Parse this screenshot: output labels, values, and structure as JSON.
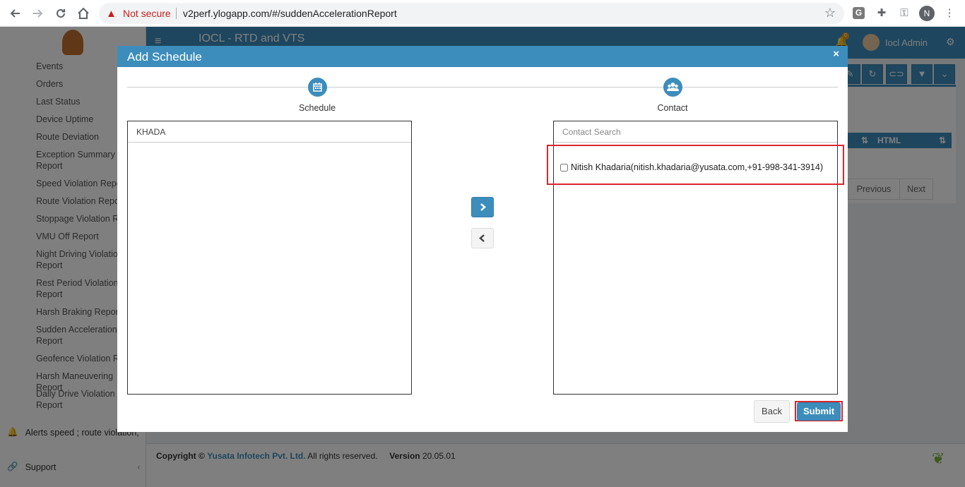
{
  "browser": {
    "security_label": "Not secure",
    "url": "v2perf.ylogapp.com/#/suddenAccelerationReport",
    "profile_initial": "N",
    "ext_g_label": "G"
  },
  "app": {
    "title": "IOCL - RTD and VTS",
    "notification_count": "0",
    "user_name": "Iocl Admin",
    "sidebar_items": [
      "Events",
      "Orders",
      "Last Status",
      "Device Uptime",
      "Route Deviation",
      "Exception Summary Report",
      "Speed Violation Report",
      "Route Violation Report",
      "Stoppage Violation Report",
      "VMU Off Report",
      "Night Driving Violation Report",
      "Rest Period Violation Report",
      "Harsh Braking Report",
      "Sudden Acceleration Report",
      "Geofence Violation Report",
      "Harsh Maneuvering Report",
      "Daily Drive Violation Report"
    ],
    "alerts_label": "Alerts speed ; route violation,",
    "support_label": "Support",
    "table_header": "HTML",
    "pager_previous": "Previous",
    "pager_next": "Next",
    "footer": {
      "copyright_prefix": "Copyright ©",
      "company": "Yusata Infotech Pvt. Ltd.",
      "rights": "All rights reserved.",
      "version_label": "Version",
      "version": "20.05.01"
    }
  },
  "modal": {
    "title": "Add Schedule",
    "close_symbol": "×",
    "steps": [
      {
        "label": "Schedule",
        "icon": "calendar-icon"
      },
      {
        "label": "Contact",
        "icon": "users-icon"
      }
    ],
    "left_list": {
      "header": "KHADA"
    },
    "right_list": {
      "search_placeholder": "Contact Search",
      "items": [
        {
          "label": "Nitish Khadaria(nitish.khadaria@yusata.com,+91-998-341-3914)",
          "checked": false
        }
      ]
    },
    "back_label": "Back",
    "submit_label": "Submit"
  },
  "colors": {
    "primary": "#3c8dbc",
    "highlight": "#d9262e",
    "overlay": "rgba(0,0,0,0.5)"
  }
}
